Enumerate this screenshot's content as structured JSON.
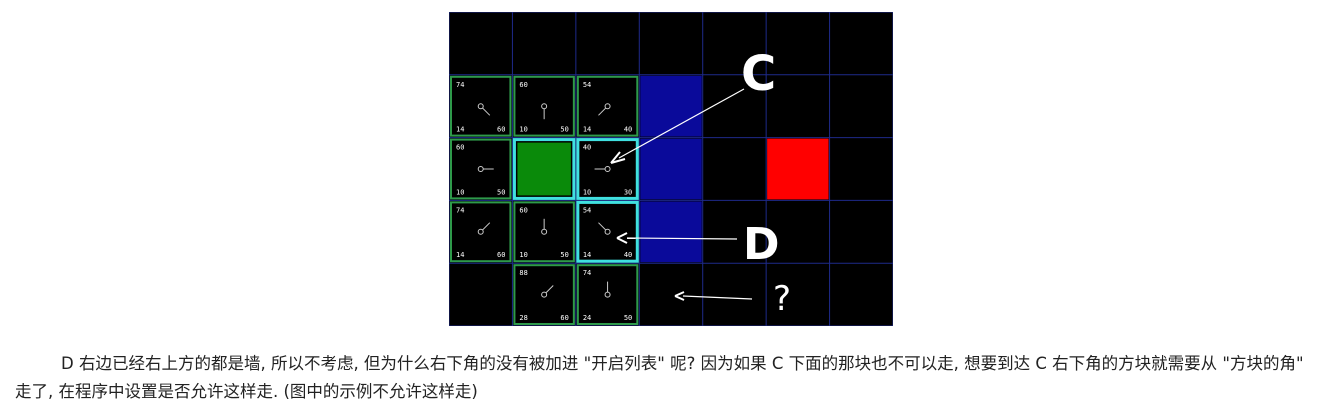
{
  "caption": "D 右边已经右上方的都是墙, 所以不考虑, 但为什么右下角的没有被加进 \"开启列表\" 呢? 因为如果 C 下面的那块也不可以走, 想要到达 C 右下角的方块就需要从 \"方块的角\" 走了, 在程序中设置是否允许这样走. (图中的示例不允许这样走)",
  "figure": {
    "colors": {
      "background": "#000000",
      "grid": "#1e2a8a",
      "open_border": "#2e9a4a",
      "current_border": "#40e0e0",
      "start": "#0a8a0a",
      "wall": "#0a0a9a",
      "target": "#ff0000",
      "annotation": "#ffffff"
    },
    "annotations": {
      "c": "C",
      "d": "D",
      "q": "?"
    },
    "cells": [
      {
        "col": 0,
        "row": 1,
        "f": "74",
        "g": "14",
        "h": "60",
        "dir": "se"
      },
      {
        "col": 1,
        "row": 1,
        "f": "60",
        "g": "10",
        "h": "50",
        "dir": "s"
      },
      {
        "col": 2,
        "row": 1,
        "f": "54",
        "g": "14",
        "h": "40",
        "dir": "sw"
      },
      {
        "col": 0,
        "row": 2,
        "f": "60",
        "g": "10",
        "h": "50",
        "dir": "e"
      },
      {
        "col": 2,
        "row": 2,
        "f": "40",
        "g": "10",
        "h": "30",
        "dir": "w",
        "current": true
      },
      {
        "col": 0,
        "row": 3,
        "f": "74",
        "g": "14",
        "h": "60",
        "dir": "ne"
      },
      {
        "col": 1,
        "row": 3,
        "f": "60",
        "g": "10",
        "h": "50",
        "dir": "n"
      },
      {
        "col": 2,
        "row": 3,
        "f": "54",
        "g": "14",
        "h": "40",
        "dir": "nw",
        "current": true
      },
      {
        "col": 1,
        "row": 4,
        "f": "88",
        "g": "28",
        "h": "60",
        "dir": "ne"
      },
      {
        "col": 2,
        "row": 4,
        "f": "74",
        "g": "24",
        "h": "50",
        "dir": "n"
      }
    ],
    "start_cell": {
      "col": 1,
      "row": 2
    },
    "walls": [
      {
        "col": 3,
        "row": 1
      },
      {
        "col": 3,
        "row": 2
      },
      {
        "col": 3,
        "row": 3
      }
    ],
    "target_cell": {
      "col": 5,
      "row": 2
    }
  }
}
